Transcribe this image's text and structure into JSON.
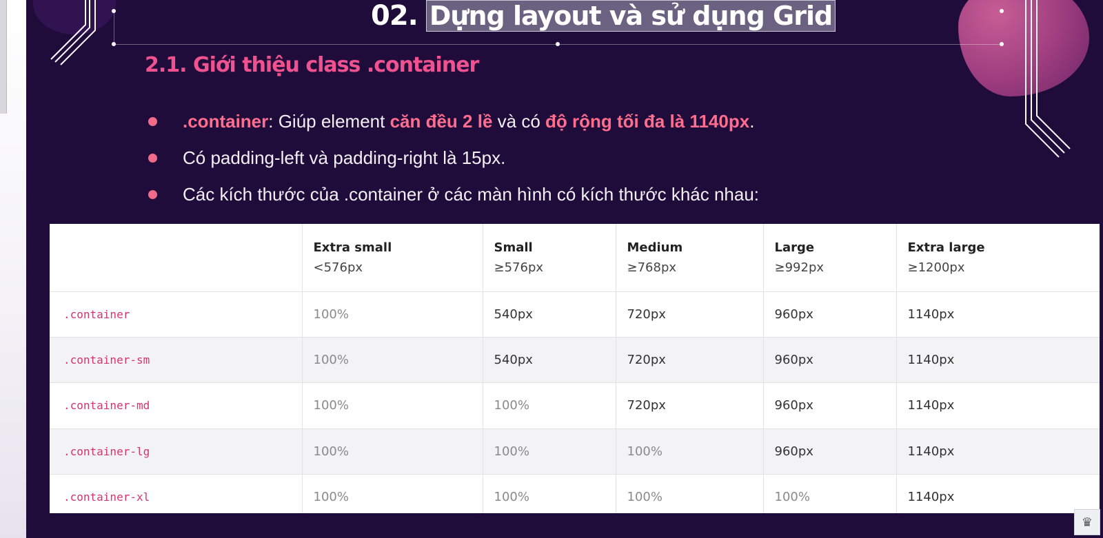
{
  "slide": {
    "title_number": "02.",
    "title_text": "Dựng layout và sử dụng Grid",
    "subtitle": "2.1. Giới thiệu class .container"
  },
  "bullets": [
    {
      "parts": [
        {
          "text": ".container",
          "highlight": true
        },
        {
          "text": ": Giúp element ",
          "highlight": false
        },
        {
          "text": "căn đều 2 lề",
          "highlight": true
        },
        {
          "text": " và có ",
          "highlight": false
        },
        {
          "text": "độ rộng tối đa là 1140px",
          "highlight": true
        },
        {
          "text": ".",
          "highlight": false
        }
      ]
    },
    {
      "parts": [
        {
          "text": "Có padding-left và padding-right là 15px.",
          "highlight": false
        }
      ]
    },
    {
      "parts": [
        {
          "text": "Các kích thước của .container ở các màn hình có kích thước khác nhau:",
          "highlight": false
        }
      ]
    }
  ],
  "table": {
    "headers": [
      {
        "name": "",
        "sub": ""
      },
      {
        "name": "Extra small",
        "sub": "<576px"
      },
      {
        "name": "Small",
        "sub": "≥576px"
      },
      {
        "name": "Medium",
        "sub": "≥768px"
      },
      {
        "name": "Large",
        "sub": "≥992px"
      },
      {
        "name": "Extra large",
        "sub": "≥1200px"
      }
    ],
    "rows": [
      {
        "label": ".container",
        "cells": [
          "100%",
          "540px",
          "720px",
          "960px",
          "1140px"
        ]
      },
      {
        "label": ".container-sm",
        "cells": [
          "100%",
          "540px",
          "720px",
          "960px",
          "1140px"
        ]
      },
      {
        "label": ".container-md",
        "cells": [
          "100%",
          "100%",
          "720px",
          "960px",
          "1140px"
        ]
      },
      {
        "label": ".container-lg",
        "cells": [
          "100%",
          "100%",
          "100%",
          "960px",
          "1140px"
        ]
      },
      {
        "label": ".container-xl",
        "cells": [
          "100%",
          "100%",
          "100%",
          "100%",
          "1140px"
        ]
      }
    ]
  },
  "colors": {
    "background": "#200c3b",
    "accent": "#f26b8a",
    "code": "#d6336c"
  }
}
